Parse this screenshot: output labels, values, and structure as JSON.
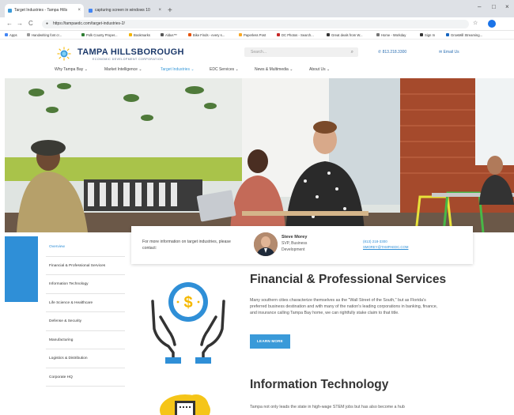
{
  "browser": {
    "tabs": [
      {
        "title": "Target Industries - Tampa Hills",
        "close": "×"
      },
      {
        "title": "capturing screen in windows 10",
        "close": "×"
      }
    ],
    "new_tab": "+",
    "window_controls": {
      "minimize": "–",
      "maximize": "□",
      "close": "×"
    },
    "nav": {
      "back": "←",
      "forward": "→",
      "reload": "C"
    },
    "url": "https://tampaedc.com/target-industries-2/",
    "bookmarks": [
      "Apps",
      "Handwriting font cr...",
      "Polk County Proper...",
      "Bookmarks",
      "Aldus™",
      "Bike Finds - every s...",
      "Paperless Post",
      "DC Photos - Search...",
      "Great deals from W...",
      "Home - Workday",
      "Sign In",
      "GrowMill Streaming..."
    ]
  },
  "site": {
    "logo_title": "TAMPA HILLSBOROUGH",
    "logo_subtitle": "ECONOMIC DEVELOPMENT CORPORATION",
    "search_placeholder": "Search...",
    "phone": "813.218.3300",
    "email_label": "Email Us",
    "nav": [
      {
        "label": "Why Tampa Bay",
        "active": false
      },
      {
        "label": "Market Intelligence",
        "active": false
      },
      {
        "label": "Target Industries",
        "active": true
      },
      {
        "label": "EDC Services",
        "active": false
      },
      {
        "label": "News & Multimedia",
        "active": false
      },
      {
        "label": "About Us",
        "active": false
      }
    ],
    "nav_chevron": "⌄"
  },
  "sidebar": {
    "items": [
      "Overview",
      "Financial & Professional Services",
      "Information Technology",
      "Life Science & Healthcare",
      "Defense & Security",
      "Manufacturing",
      "Logistics & Distribution",
      "Corporate HQ"
    ]
  },
  "contact": {
    "prompt": "For more information on target industries, please contact:",
    "name": "Steve Morey",
    "title": "SVP, Business Development",
    "phone": "(813) 218-3300",
    "email": "SMOREY@TAMPAEDC.COM"
  },
  "sections": {
    "financial": {
      "heading": "Financial & Professional Services",
      "body": "Many southern cities characterize themselves as the \"Wall Street of the South,\" but as Florida's preferred business destination and with many of the nation's leading corporations in banking, finance, and insurance calling Tampa Bay home, we can rightfully stake claim to that title.",
      "button": "LEARN MORE"
    },
    "it": {
      "heading": "Information Technology",
      "body": "Tampa not only leads the state in high-wage STEM jobs but has also become a hub"
    }
  },
  "colors": {
    "accent": "#3a9ad9",
    "sidebar_block": "#2f8fd7",
    "logo_navy": "#1d3a6b",
    "money_icon_circle": "#2f8fd7",
    "it_cloud": "#f5c518"
  },
  "icons": {
    "lock": "lock-icon",
    "search": "search-icon",
    "phone": "phone-icon",
    "email": "email-icon",
    "money_hands": "hands-holding-money-icon",
    "cloud_laptop": "cloud-laptop-icon"
  }
}
